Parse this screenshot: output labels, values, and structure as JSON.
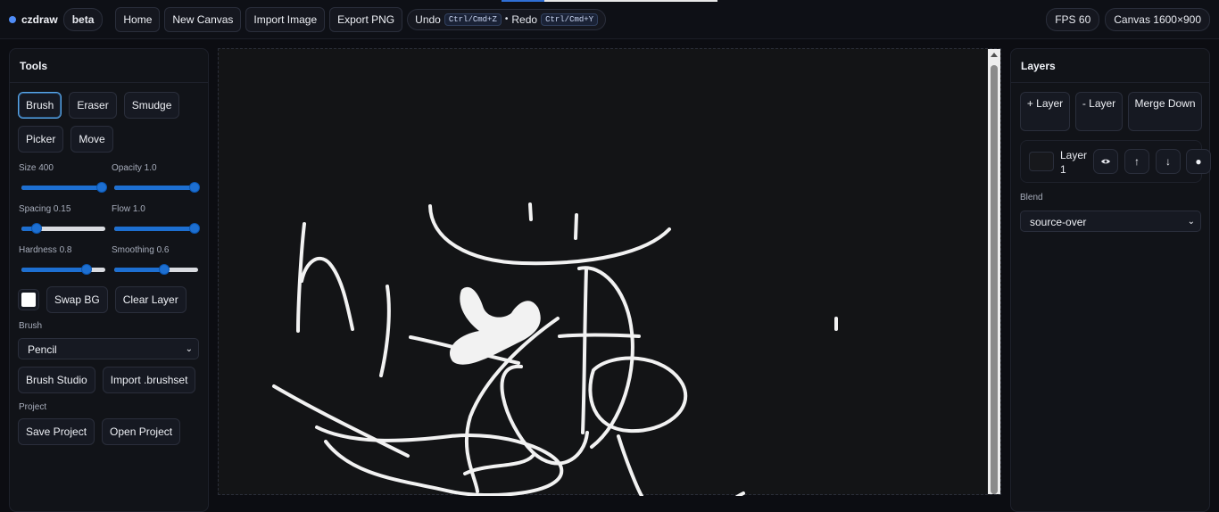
{
  "app": {
    "name": "czdraw",
    "badge": "beta",
    "progress": 0.2
  },
  "toolbar": {
    "home": "Home",
    "new_canvas": "New Canvas",
    "import_image": "Import Image",
    "export_png": "Export PNG",
    "undo": "Undo",
    "undo_shortcut": "Ctrl/Cmd+Z",
    "separator": "•",
    "redo": "Redo",
    "redo_shortcut": "Ctrl/Cmd+Y",
    "fps": "FPS 60",
    "canvas_size": "Canvas 1600×900"
  },
  "tools": {
    "title": "Tools",
    "items": [
      "Brush",
      "Eraser",
      "Smudge",
      "Picker",
      "Move"
    ],
    "active": "Brush",
    "sliders": [
      {
        "label": "Size 400",
        "value": 1.0
      },
      {
        "label": "Opacity 1.0",
        "value": 1.0
      },
      {
        "label": "Spacing 0.15",
        "value": 0.15
      },
      {
        "label": "Flow 1.0",
        "value": 1.0
      },
      {
        "label": "Hardness 0.8",
        "value": 0.8
      },
      {
        "label": "Smoothing 0.6",
        "value": 0.6
      }
    ],
    "color": "#ffffff",
    "swap_bg": "Swap BG",
    "clear_layer": "Clear Layer",
    "brush_section": "Brush",
    "brush_select": "Pencil",
    "brush_studio": "Brush Studio",
    "import_brushset": "Import .brushset",
    "project_section": "Project",
    "save_project": "Save Project",
    "open_project": "Open Project"
  },
  "layers": {
    "title": "Layers",
    "add_label": "+ Layer",
    "remove_label": "- Layer",
    "merge_label": "Merge Down",
    "items": [
      {
        "name": "Layer 1"
      }
    ],
    "visibility_icon": "eye-icon",
    "blend_label": "Blend",
    "blend_value": "source-over"
  }
}
